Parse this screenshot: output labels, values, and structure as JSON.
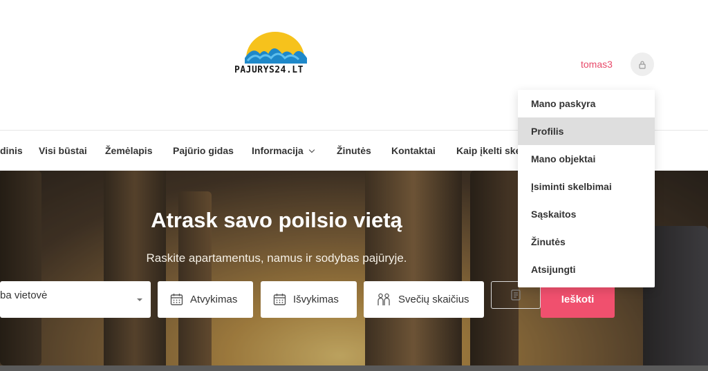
{
  "header": {
    "logo_text": "PAJURYS24.LT",
    "username": "tomas3",
    "accent_color": "#f0506e"
  },
  "nav": {
    "items": [
      {
        "label": "dinis"
      },
      {
        "label": "Visi būstai"
      },
      {
        "label": "Žemėlapis"
      },
      {
        "label": "Pajūrio gidas"
      },
      {
        "label": "Informacija",
        "has_dropdown": true
      },
      {
        "label": "Žinutės"
      },
      {
        "label": "Kontaktai"
      },
      {
        "label": "Kaip įkelti skel"
      }
    ]
  },
  "hero": {
    "title": "Atrask savo poilsio vietą",
    "subtitle": "Raskite apartamentus, namus ir sodybas pajūryje."
  },
  "search": {
    "location_value": "ba vietovė",
    "checkin_label": "Atvykimas",
    "checkout_label": "Išvykimas",
    "guests_label": "Svečių skaičius",
    "submit_label": "Ieškoti"
  },
  "user_menu": {
    "items": [
      {
        "label": "Mano paskyra"
      },
      {
        "label": "Profilis",
        "active": true
      },
      {
        "label": "Mano objektai"
      },
      {
        "label": "Įsiminti skelbimai"
      },
      {
        "label": "Sąskaitos"
      },
      {
        "label": "Žinutės"
      },
      {
        "label": "Atsijungti"
      }
    ]
  }
}
